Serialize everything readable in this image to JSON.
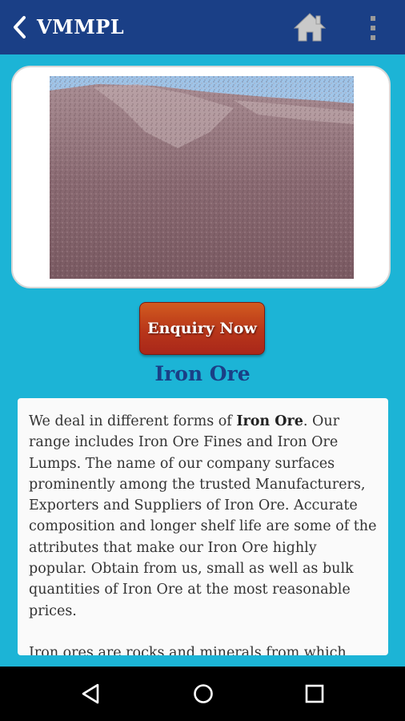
{
  "appbar": {
    "title": "VMMPL",
    "icons": [
      "back-arrow-icon",
      "home-icon",
      "more-vert-icon"
    ]
  },
  "product": {
    "image": "iron-ore-photo",
    "enquiry_label": "Enquiry Now",
    "name": "Iron Ore"
  },
  "description": {
    "p1_pre": " We deal in different forms of ",
    "p1_bold": "Iron Ore",
    "p1_post": ". Our range includes Iron Ore Fines and Iron Ore Lumps. The name of our company surfaces prominently among the trusted Manufacturers, Exporters and Suppliers of Iron Ore. Accurate composition and longer shelf life are some of the attributes that make our Iron Ore highly popular. Obtain from us, small as well as bulk quantities of Iron Ore at the most reasonable prices.",
    "p2": " Iron ores are rocks and minerals from which"
  },
  "navbar": {
    "icons": [
      "nav-back-icon",
      "nav-home-icon",
      "nav-recents-icon"
    ]
  },
  "colors": {
    "appbar": "#1a3f86",
    "background": "#1cb4d6",
    "button": "#b8361a",
    "heading": "#1a3f86"
  }
}
